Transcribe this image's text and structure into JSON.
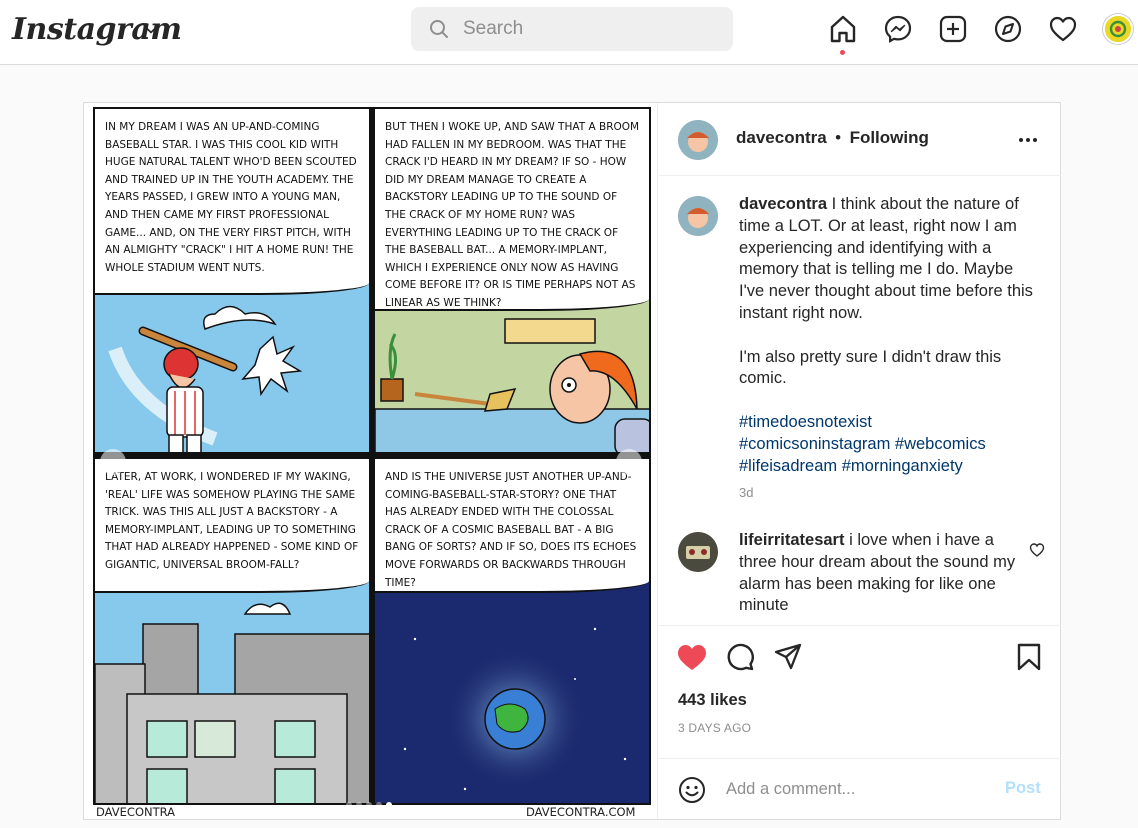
{
  "header": {
    "logo": "Instagram",
    "search_placeholder": "Search"
  },
  "post": {
    "author": "davecontra",
    "follow_state": "Following",
    "caption_para1": "I think about the nature of time a LOT. Or at least, right now I am experiencing and identifying with a memory that is telling me I do. Maybe I've never thought about time before this instant right now.",
    "caption_para2": "I'm also pretty sure I didn't draw this comic.",
    "hashtags": [
      "#timedoesnotexist",
      "#comicsoninstagram",
      "#webcomics",
      "#lifeisadream",
      "#morninganxiety"
    ],
    "time_ago": "3d",
    "comment_user": "lifeirritatesart",
    "comment_text": "i love when i have a three hour dream about the sound my alarm has been making for like one minute",
    "likes": "443 likes",
    "date": "3 DAYS AGO",
    "comment_placeholder": "Add a comment...",
    "post_button": "Post"
  },
  "comic": {
    "panel1": "In my dream I was an up-and-coming baseball star. I was this cool kid with huge natural talent who'd been scouted and trained up in the youth academy. The years passed, I grew into a young man, and then came my first professional game... And, on the very first pitch, with an almighty \"CRACK\" I hit a home run! The whole stadium went nuts.",
    "panel2": "But then I woke up, and saw that a broom had fallen in my bedroom. Was that the crack I'd heard in my dream? If so - how did my dream manage to create a backstory leading up to the sound of the crack of my home run? Was everything leading up to the crack of the baseball bat... a memory-implant, which I experience only now as having come before it? Or is time perhaps not as linear as we think?",
    "panel3": "Later, at work, I wondered if my waking, 'real' life was somehow playing the same trick. Was this all just a backstory - a memory-implant, leading up to something that had already happened - some kind of gigantic, universal broom-fall?",
    "panel4": "And is the universe just another up-and-coming-baseball-star-story? One that has already ended with the colossal crack of a cosmic baseball bat - a big bang of sorts? And if so, does its echoes move forwards or backwards through time?",
    "credit_left": "DAVECONTRA",
    "credit_right": "DAVECONTRA.COM"
  },
  "colors": {
    "accent_like": "#ed4956",
    "link": "#00376b",
    "post_btn": "#b2dffc"
  }
}
